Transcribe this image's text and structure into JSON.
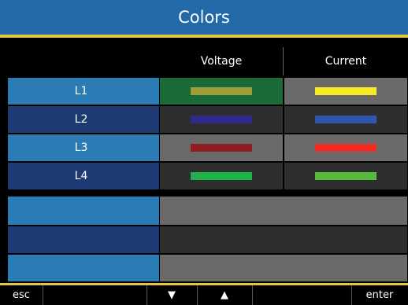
{
  "title": "Colors",
  "columns": {
    "voltage": "Voltage",
    "current": "Current"
  },
  "rows": [
    {
      "label": "L1",
      "voltage_color": "#9d9d3c",
      "current_color": "#f7eb26"
    },
    {
      "label": "L2",
      "voltage_color": "#2f2a8c",
      "current_color": "#2e58b0"
    },
    {
      "label": "L3",
      "voltage_color": "#8e1e22",
      "current_color": "#f12a24"
    },
    {
      "label": "L4",
      "voltage_color": "#1fb14a",
      "current_color": "#59bb3d"
    }
  ],
  "buttons": {
    "esc": "esc",
    "down": "▼",
    "up": "▲",
    "enter": "enter"
  },
  "colors": {
    "title_bg": "#2369a7",
    "accent": "#e2c640",
    "row_label_light": "#2b7bb5",
    "row_label_dark": "#1d3a73",
    "cell_gray": "#6a6a6a",
    "cell_dark": "#2e2e2e",
    "selected_cell": "#1b6b3a"
  }
}
